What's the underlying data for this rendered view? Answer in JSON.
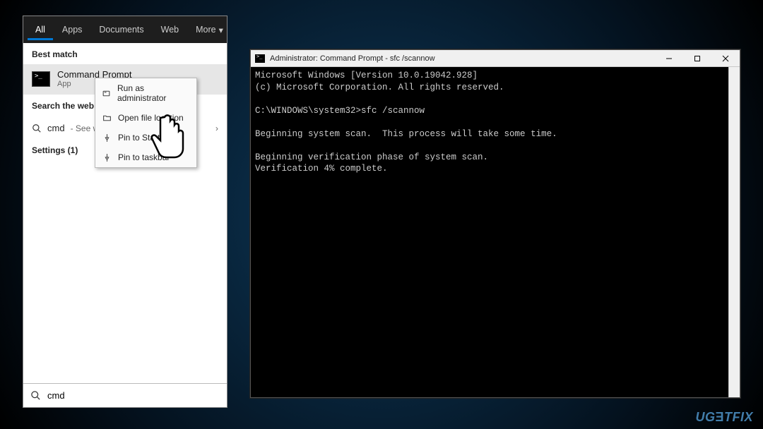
{
  "search": {
    "tabs": {
      "all": "All",
      "apps": "Apps",
      "documents": "Documents",
      "web": "Web",
      "more": "More"
    },
    "best_match_label": "Best match",
    "best_match": {
      "title": "Command Prompt",
      "subtitle": "App"
    },
    "search_web_label": "Search the web",
    "web_result": {
      "query": "cmd",
      "hint": "- See we"
    },
    "settings_label": "Settings (1)",
    "context_menu": {
      "run_admin": "Run as administrator",
      "open_location": "Open file location",
      "pin_start": "Pin to Start",
      "pin_taskbar": "Pin to taskbar"
    },
    "input_value": "cmd"
  },
  "terminal": {
    "title": "Administrator: Command Prompt - sfc  /scannow",
    "lines": "Microsoft Windows [Version 10.0.19042.928]\n(c) Microsoft Corporation. All rights reserved.\n\nC:\\WINDOWS\\system32>sfc /scannow\n\nBeginning system scan.  This process will take some time.\n\nBeginning verification phase of system scan.\nVerification 4% complete."
  },
  "watermark": "UGETFIX"
}
